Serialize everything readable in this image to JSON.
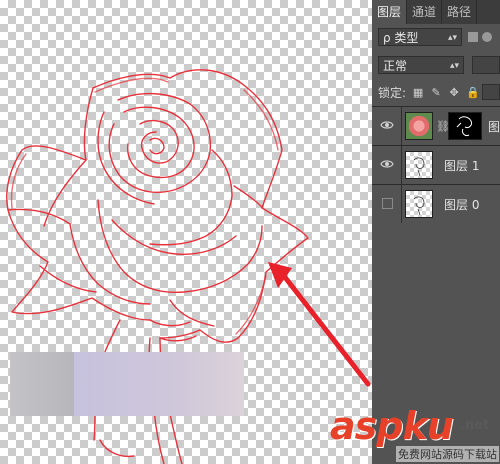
{
  "panel": {
    "tabs": [
      {
        "label": "图层",
        "active": true
      },
      {
        "label": "通道",
        "active": false
      },
      {
        "label": "路径",
        "active": false
      }
    ],
    "filter_label": "ρ 类型",
    "blend_mode": "正常",
    "lock_label": "锁定:",
    "lock_icons": [
      "lock-pixels-icon",
      "lock-brush-icon",
      "lock-move-icon",
      "lock-all-icon"
    ],
    "layers": [
      {
        "name": "",
        "visible": true,
        "thumb": "photo",
        "has_mask": true,
        "cut_label": "图"
      },
      {
        "name": "图层 1",
        "visible": true,
        "thumb": "checker",
        "has_mask": false
      },
      {
        "name": "图层 0",
        "visible": false,
        "thumb": "checker",
        "has_mask": false
      }
    ]
  },
  "canvas": {
    "stroke_color": "#e8323c",
    "arrow_color": "#e8212b"
  },
  "watermark": {
    "main": "aspku",
    "tld": ".net",
    "sub": "免费网站源码下载站"
  }
}
